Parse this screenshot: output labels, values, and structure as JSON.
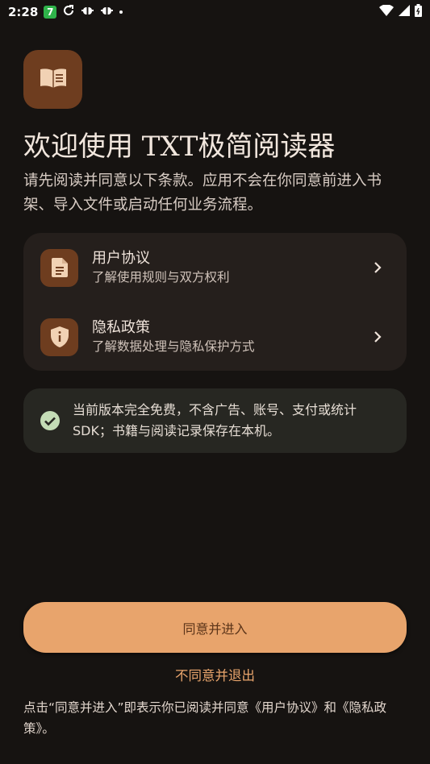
{
  "status_bar": {
    "time": "2:28",
    "badge": "7",
    "icons": [
      "sync-icon",
      "bug-icon",
      "bug-icon",
      "dot-icon",
      "wifi-icon",
      "signal-icon",
      "battery-icon"
    ]
  },
  "app": {
    "icon": "book-icon",
    "accent": "#e8a46c"
  },
  "header": {
    "title": "欢迎使用 TXT极简阅读器",
    "subtitle": "请先阅读并同意以下条款。应用不会在你同意前进入书架、导入文件或启动任何业务流程。"
  },
  "agreements": [
    {
      "icon": "document-icon",
      "title": "用户协议",
      "desc": "了解使用规则与双方权利"
    },
    {
      "icon": "shield-icon",
      "title": "隐私政策",
      "desc": "了解数据处理与隐私保护方式"
    }
  ],
  "info": {
    "icon": "check-circle-icon",
    "text": "当前版本完全免费，不含广告、账号、支付或统计SDK；书籍与阅读记录保存在本机。"
  },
  "actions": {
    "agree_label": "同意并进入",
    "decline_label": "不同意并退出"
  },
  "footnote": "点击“同意并进入”即表示你已阅读并同意《用户协议》和《隐私政策》。"
}
